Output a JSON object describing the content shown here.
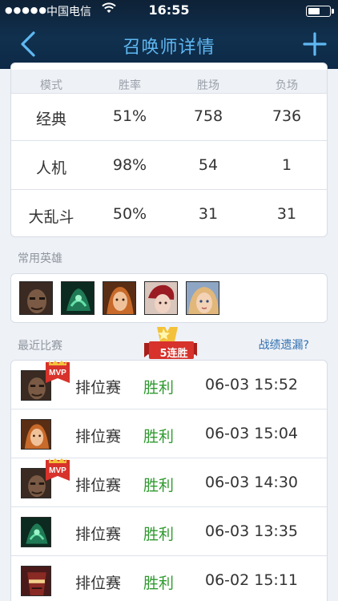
{
  "status_bar": {
    "signal": "●●●●●",
    "carrier": "中国电信",
    "time": "16:55",
    "battery_level": 0.55
  },
  "nav": {
    "title": "召唤师详情",
    "back_icon": "chevron-left-icon",
    "add_icon": "plus-icon"
  },
  "stats": {
    "headers": [
      "模式",
      "胜率",
      "胜场",
      "负场"
    ],
    "rows": [
      [
        "经典",
        "51%",
        "758",
        "736"
      ],
      [
        "人机",
        "98%",
        "54",
        "1"
      ],
      [
        "大乱斗",
        "50%",
        "31",
        "31"
      ]
    ]
  },
  "heroes": {
    "label": "常用英雄",
    "items": [
      "hero-portrait-icon",
      "hero-portrait-icon",
      "hero-portrait-icon",
      "hero-portrait-icon",
      "hero-portrait-icon"
    ]
  },
  "recent": {
    "label": "最近比赛",
    "streak": "5连胜",
    "report_link": "战绩遗漏?",
    "mvp_text": "MVP",
    "matches": [
      {
        "mode": "排位赛",
        "result": "胜利",
        "time": "06-03 15:52",
        "mvp": true
      },
      {
        "mode": "排位赛",
        "result": "胜利",
        "time": "06-03 15:04",
        "mvp": false
      },
      {
        "mode": "排位赛",
        "result": "胜利",
        "time": "06-03 14:30",
        "mvp": true
      },
      {
        "mode": "排位赛",
        "result": "胜利",
        "time": "06-03 13:35",
        "mvp": false
      },
      {
        "mode": "排位赛",
        "result": "胜利",
        "time": "06-02 15:11",
        "mvp": false
      }
    ]
  },
  "colors": {
    "header_bg": "#10304e",
    "title": "#5fb8f2",
    "win": "#2f9a2f",
    "link": "#2f6fb0",
    "streak_red": "#d7322b",
    "mvp_red": "#d7322b"
  }
}
